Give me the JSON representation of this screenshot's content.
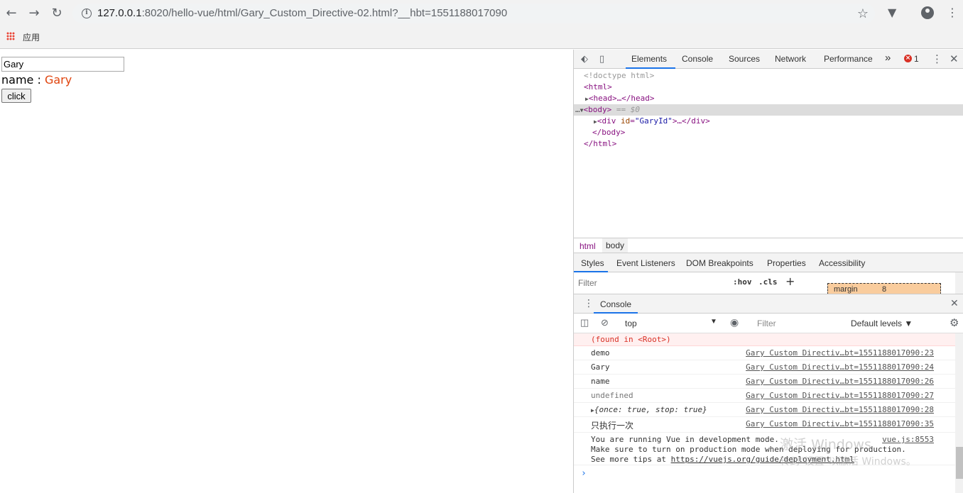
{
  "browser": {
    "url_host": "127.0.0.1",
    "url_rest": ":8020/hello-vue/html/Gary_Custom_Directive-02.html?__hbt=1551188017090",
    "bookmark_apps_label": "应用"
  },
  "page": {
    "input_value": "Gary",
    "name_label": "name : ",
    "name_value": "Gary",
    "button_label": "click"
  },
  "devtools": {
    "tabs": [
      "Elements",
      "Console",
      "Sources",
      "Network",
      "Performance"
    ],
    "more_tabs": "»",
    "error_count": "1",
    "dom": {
      "doctype": "<!doctype html>",
      "html_open": "<html>",
      "head": "<head>…</head>",
      "body_open": "<body>",
      "body_eq": " == $0",
      "div_open": "<div ",
      "div_attr": "id",
      "div_attr_val": "\"GaryId\"",
      "div_close": ">…</div>",
      "body_close": "</body>",
      "html_close": "</html>",
      "ellipsis": "…"
    },
    "breadcrumbs": [
      "html",
      "body"
    ],
    "sub_tabs": [
      "Styles",
      "Event Listeners",
      "DOM Breakpoints",
      "Properties",
      "Accessibility"
    ],
    "styles_filter_placeholder": "Filter",
    "hov": ":hov",
    "cls": ".cls",
    "plus": "+",
    "box_model": {
      "label": "margin",
      "value": "8"
    },
    "console_tab": "Console",
    "console_context": "top",
    "console_filter_placeholder": "Filter",
    "console_levels": "Default levels ▼",
    "logs": [
      {
        "msg": "(found in <Root>)",
        "src": "",
        "type": "error"
      },
      {
        "msg": "demo",
        "src": "Gary Custom Directiv…bt=1551188017090:23",
        "type": "log"
      },
      {
        "msg": "Gary",
        "src": "Gary Custom Directiv…bt=1551188017090:24",
        "type": "log"
      },
      {
        "msg": "name",
        "src": "Gary Custom Directiv…bt=1551188017090:26",
        "type": "log"
      },
      {
        "msg": "undefined",
        "src": "Gary Custom Directiv…bt=1551188017090:27",
        "type": "log"
      },
      {
        "msg": "{once: true, stop: true}",
        "src": "Gary Custom Directiv…bt=1551188017090:28",
        "type": "log"
      },
      {
        "msg": "只执行一次",
        "src": "Gary Custom Directiv…bt=1551188017090:35",
        "type": "log"
      }
    ],
    "vue_msg_1": "You are running Vue in development mode.",
    "vue_msg_2": "Make sure to turn on production mode when deploying for production.",
    "vue_msg_3_prefix": "See more tips at ",
    "vue_msg_3_link": "https://vuejs.org/guide/deployment.html",
    "vue_src": "vue.js:8553",
    "prompt": "›",
    "watermark_1": "激活 Windows",
    "watermark_2": "转到\"设置\"以激活 Windows。"
  }
}
